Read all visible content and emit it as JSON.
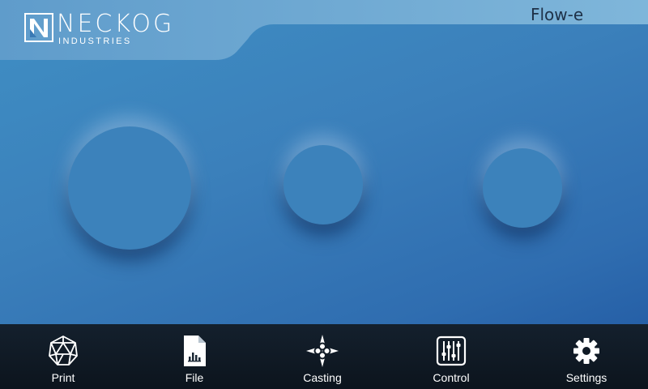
{
  "header": {
    "brand_name": "NECKOG",
    "brand_sub": "INDUSTRIES",
    "product": "Flow-e",
    "logo_icon": "neckog-logo-icon"
  },
  "colors": {
    "background": "#3b80bb",
    "header_tab": "#6fa9d2",
    "navbar": "#101a25",
    "nav_text": "#ffffff",
    "product_text": "#1e3148"
  },
  "knobs": [
    "knob-large",
    "knob-medium",
    "knob-small"
  ],
  "nav": {
    "items": [
      {
        "label": "Print",
        "icon": "polyhedron-icon"
      },
      {
        "label": "File",
        "icon": "file-chart-icon"
      },
      {
        "label": "Casting",
        "icon": "casting-diamond-icon"
      },
      {
        "label": "Control",
        "icon": "sliders-icon"
      },
      {
        "label": "Settings",
        "icon": "gear-icon"
      }
    ]
  }
}
